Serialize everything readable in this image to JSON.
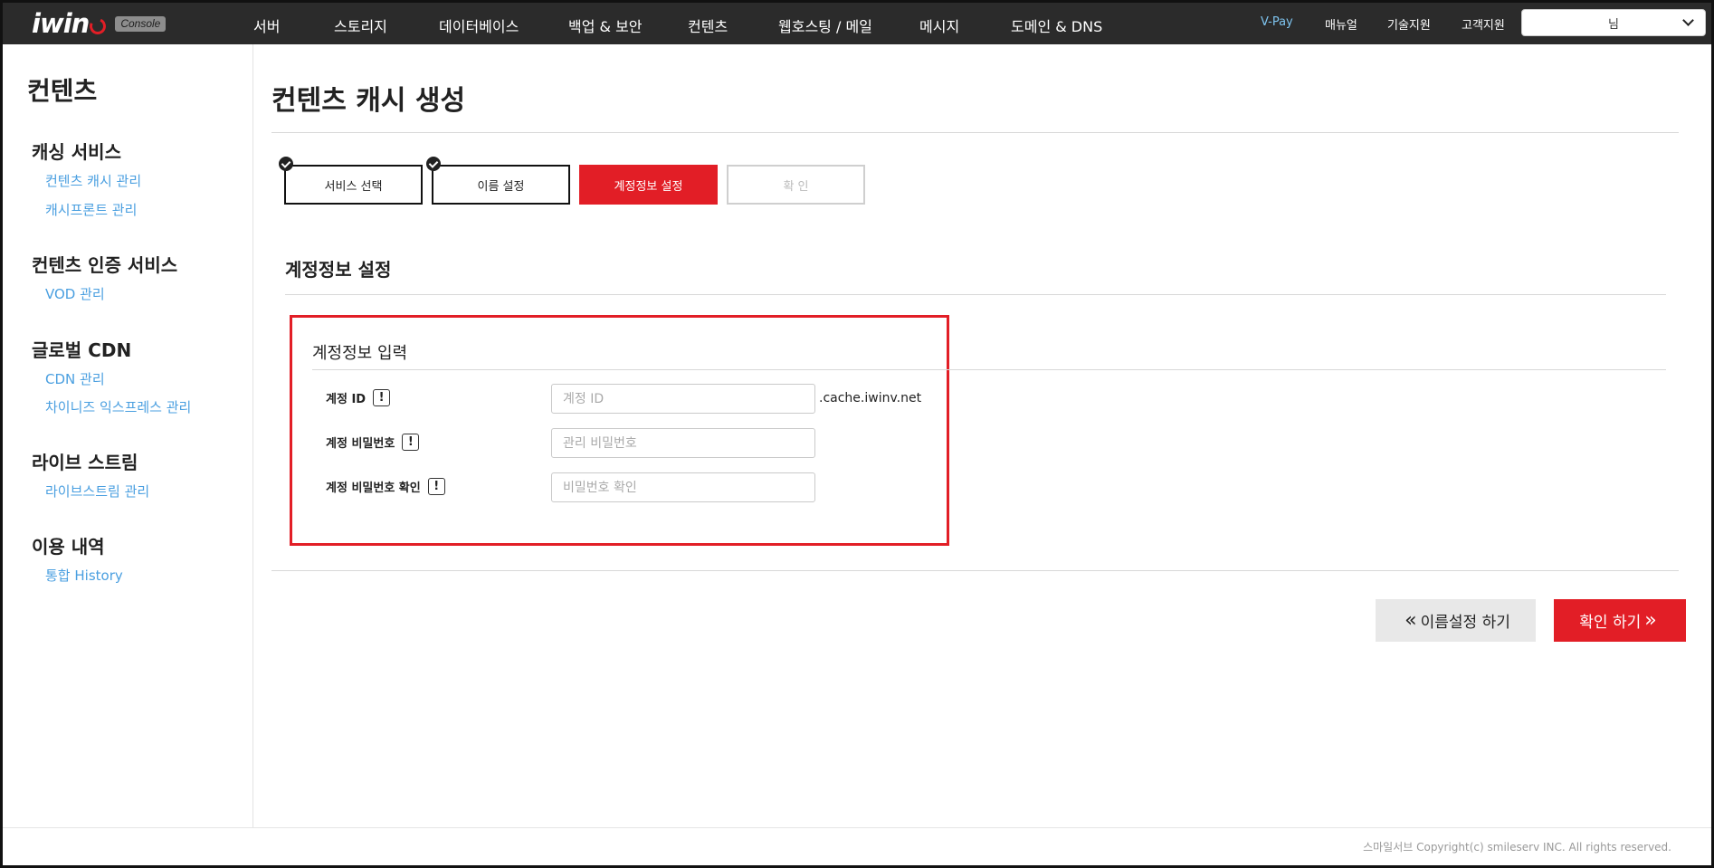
{
  "header": {
    "logo_text": "iwin",
    "logo_badge": "Console",
    "nav": [
      "서버",
      "스토리지",
      "데이터베이스",
      "백업 & 보안",
      "컨텐츠",
      "웹호스팅 / 메일",
      "메시지",
      "도메인 & DNS"
    ],
    "right_links": [
      "V-Pay",
      "매뉴얼",
      "기술지원",
      "고객지원"
    ],
    "user_name": "님",
    "colors": {
      "bar": "#2b2b2b",
      "vpay": "#7ec4ef",
      "accent": "#e21e26"
    }
  },
  "sidebar": {
    "title": "컨텐츠",
    "groups": [
      {
        "label": "캐싱 서비스",
        "links": [
          "컨텐츠 캐시 관리",
          "캐시프론트 관리"
        ]
      },
      {
        "label": "컨텐츠 인증 서비스",
        "links": [
          "VOD 관리"
        ]
      },
      {
        "label": "글로벌 CDN",
        "links": [
          "CDN 관리",
          "차이니즈 익스프레스 관리"
        ]
      },
      {
        "label": "라이브 스트림",
        "links": [
          "라이브스트림 관리"
        ]
      },
      {
        "label": "이용 내역",
        "links": [
          "통합 History"
        ]
      }
    ],
    "link_color": "#4a9fe0"
  },
  "main": {
    "page_title": "컨텐츠 캐시 생성",
    "steps": [
      {
        "label": "서비스 선택",
        "state": "done"
      },
      {
        "label": "이름 설정",
        "state": "done"
      },
      {
        "label": "계정정보 설정",
        "state": "active"
      },
      {
        "label": "확 인",
        "state": "disabled"
      }
    ],
    "section_title": "계정정보 설정",
    "form": {
      "title": "계정정보 입력",
      "fields": [
        {
          "label": "계정 ID",
          "placeholder": "계정 ID",
          "info_icon": "!"
        },
        {
          "label": "계정 비밀번호",
          "placeholder": "관리 비밀번호",
          "info_icon": "!"
        },
        {
          "label": "계정 비밀번호 확인",
          "placeholder": "비밀번호 확인",
          "info_icon": "!"
        }
      ],
      "id_suffix": ".cache.iwinv.net"
    },
    "buttons": {
      "prev": "이름설정 하기",
      "next": "확인 하기",
      "chevron": "»",
      "chevron_left": "«"
    }
  },
  "footer": {
    "copyright": "스마일서브 Copyright(c) smileserv INC. All rights reserved."
  }
}
